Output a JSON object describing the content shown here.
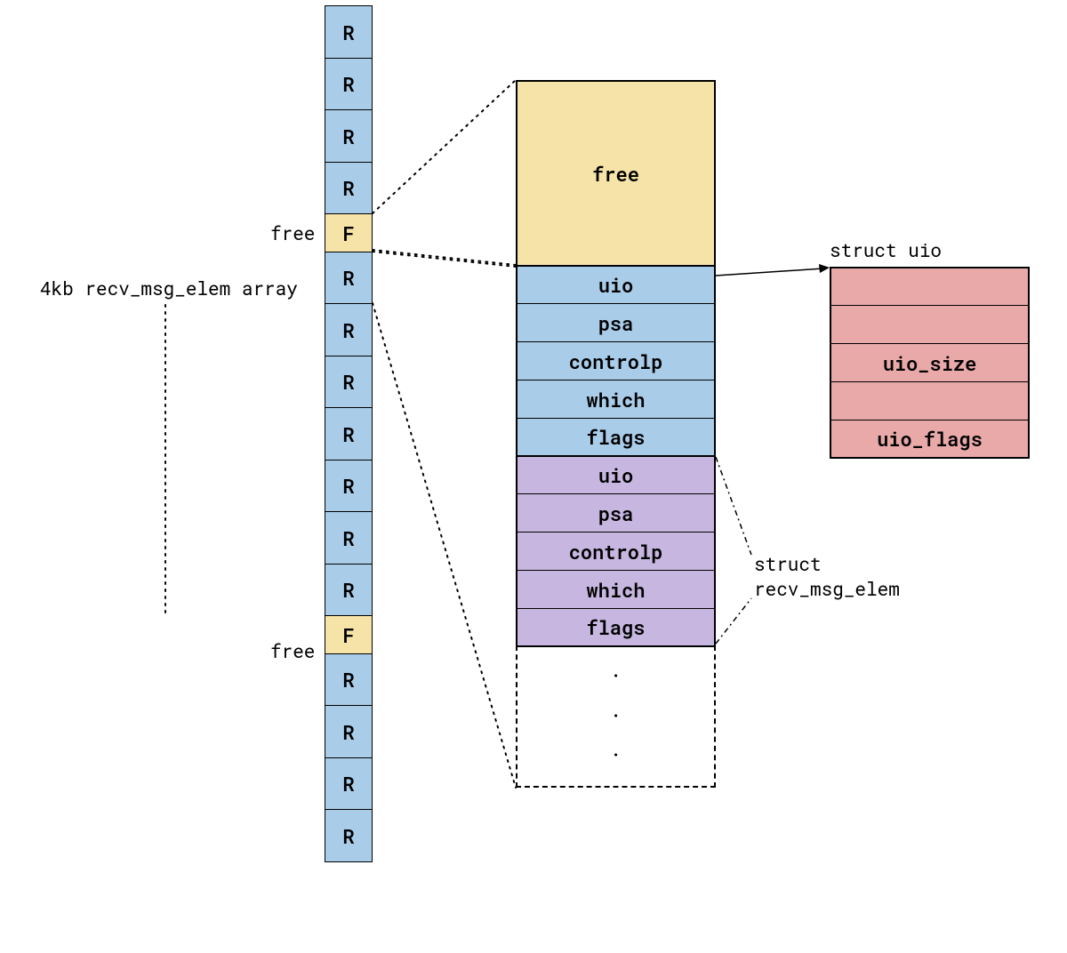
{
  "left_column": {
    "cells": [
      "R",
      "R",
      "R",
      "R",
      "F",
      "R",
      "R",
      "R",
      "R",
      "R",
      "R",
      "R",
      "F",
      "R",
      "R",
      "R",
      "R"
    ]
  },
  "left_labels": {
    "free1": "free",
    "free2": "free",
    "array_desc": "4kb recv_msg_elem array"
  },
  "middle_column": {
    "free_label": "free",
    "group1": [
      "uio",
      "psa",
      "controlp",
      "which",
      "flags"
    ],
    "group2": [
      "uio",
      "psa",
      "controlp",
      "which",
      "flags"
    ],
    "dots": "·\n·\n·"
  },
  "middle_label": "struct\nrecv_msg_elem",
  "right_column": {
    "title": "struct uio",
    "rows": [
      "",
      "",
      "uio_size",
      "",
      "uio_flags"
    ]
  }
}
